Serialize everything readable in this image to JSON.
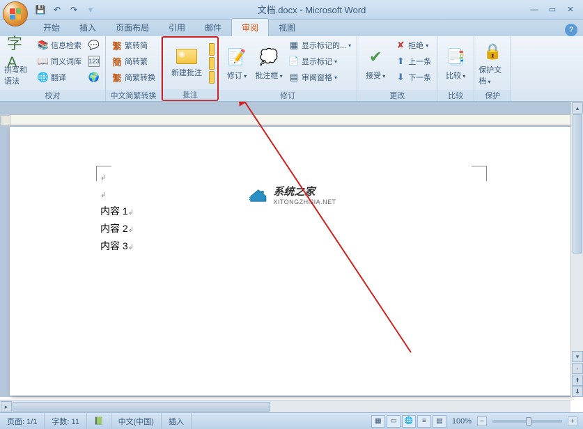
{
  "title": "文档.docx - Microsoft Word",
  "tabs": {
    "start": "开始",
    "insert": "插入",
    "layout": "页面布局",
    "references": "引用",
    "mail": "邮件",
    "review": "审阅",
    "view": "视图"
  },
  "ribbon": {
    "proofing": {
      "label": "校对",
      "spelling": "拼写和语法",
      "research": "信息检索",
      "thesaurus": "同义词库",
      "translate": "翻译",
      "wordcount_icon": "123"
    },
    "chinese": {
      "label": "中文简繁转换",
      "simp_to_trad": "繁转简",
      "trad_to_simp": "简转繁",
      "convert": "简繁转换"
    },
    "comments": {
      "label": "批注",
      "new_comment": "新建批注"
    },
    "tracking": {
      "label": "修订",
      "track": "修订",
      "balloons": "批注框",
      "show_markup_display": "显示标记的...",
      "show_markup": "显示标记",
      "reviewing_pane": "审阅窗格"
    },
    "changes": {
      "label": "更改",
      "accept": "接受",
      "reject": "拒绝",
      "previous": "上一条",
      "next": "下一条"
    },
    "compare": {
      "label": "比较",
      "btn": "比较"
    },
    "protect": {
      "label": "保护",
      "btn": "保护文档"
    }
  },
  "document": {
    "line1": "内容 1",
    "line2": "内容 2",
    "line3": "内容 3"
  },
  "watermark": {
    "main": "系统之家",
    "sub": "XITONGZHIJIA.NET"
  },
  "statusbar": {
    "page": "页面: 1/1",
    "words": "字数: 11",
    "language": "中文(中国)",
    "mode": "插入",
    "zoom": "100%"
  }
}
